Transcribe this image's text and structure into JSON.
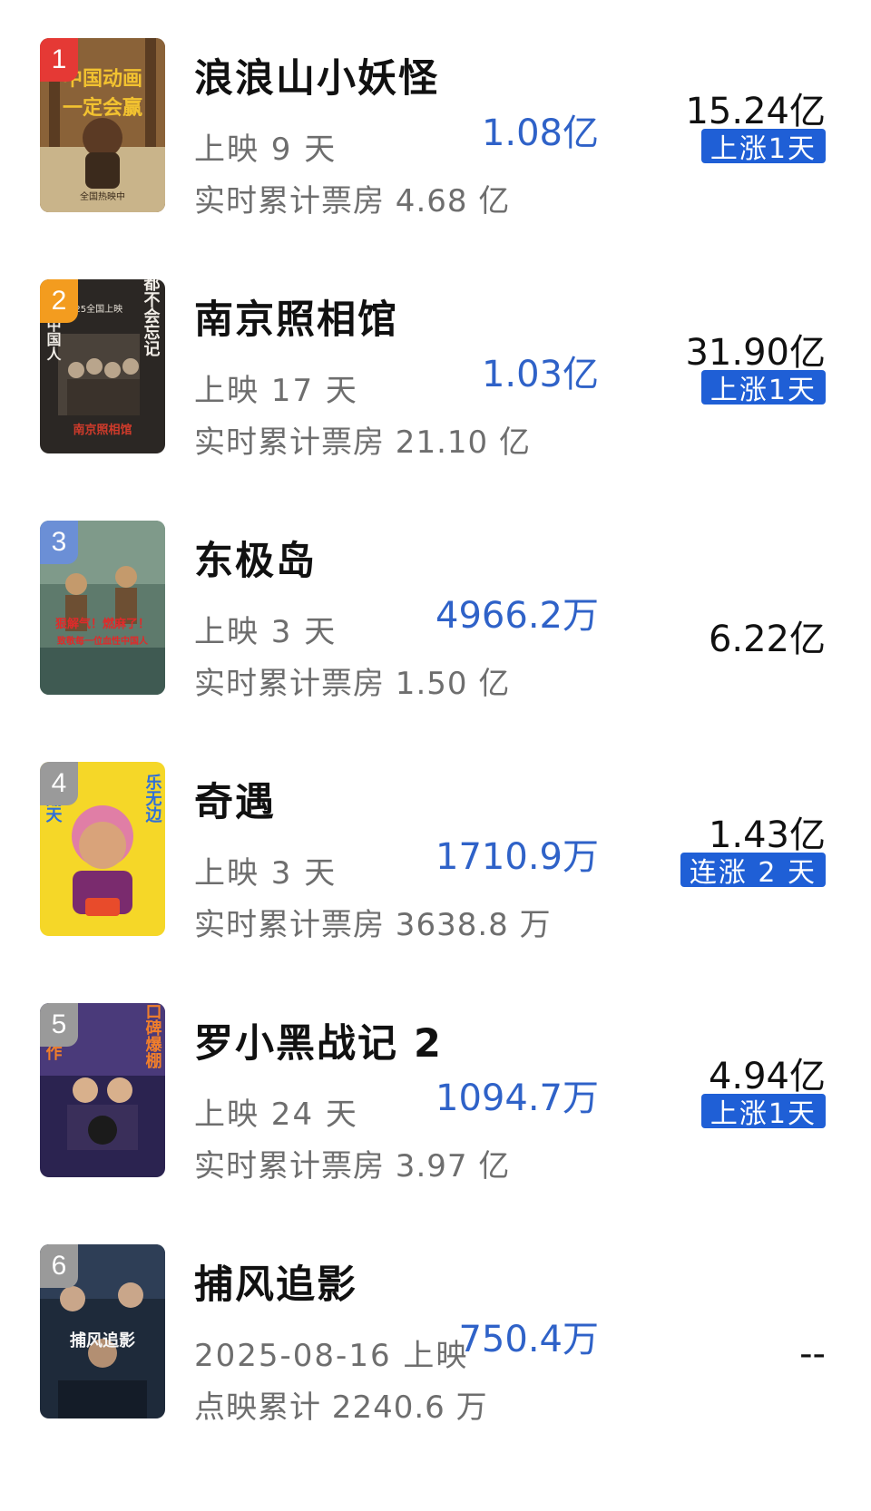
{
  "movies": [
    {
      "rank": "1",
      "rank_color": "#e53935",
      "title": "浪浪山小妖怪",
      "days": "上映 9 天",
      "cume": "实时累计票房 4.68 亿",
      "daily": "1.08亿",
      "total": "15.24亿",
      "badge": "上涨1天",
      "poster_icon": "poster-langlangshan",
      "poster_text": [
        "中国动画",
        "一定会赢",
        "全国热映中"
      ]
    },
    {
      "rank": "2",
      "rank_color": "#f39c1f",
      "title": "南京照相馆",
      "days": "上映 17 天",
      "cume": "实时累计票房 21.10 亿",
      "daily": "1.03亿",
      "total": "31.90亿",
      "badge": "上涨1天",
      "poster_icon": "poster-nanjing",
      "poster_text": [
        "都不会忘记",
        "一个中国人",
        "南京照相馆",
        "7.25全国上映"
      ]
    },
    {
      "rank": "3",
      "rank_color": "#6b8fd6",
      "title": "东极岛",
      "days": "上映 3 天",
      "cume": "实时累计票房 1.50 亿",
      "daily": "4966.2万",
      "total": "6.22亿",
      "badge": "",
      "poster_icon": "poster-dongjidao",
      "poster_text": [
        "狠解气！燃麻了！",
        "致敬每一位血性中国人"
      ]
    },
    {
      "rank": "4",
      "rank_color": "#9a9a9a",
      "title": "奇遇",
      "days": "上映 3 天",
      "cume": "实时累计票房 3638.8 万",
      "daily": "1710.9万",
      "total": "1.43亿",
      "badge": "连涨 2 天",
      "poster_icon": "poster-qiyu",
      "poster_text": [
        "笑翻天",
        "乐无边"
      ]
    },
    {
      "rank": "5",
      "rank_color": "#9a9a9a",
      "title": "罗小黑战记 2",
      "days": "上映 24 天",
      "cume": "实时累计票房 3.97 亿",
      "daily": "1094.7万",
      "total": "4.94亿",
      "badge": "上涨1天",
      "poster_icon": "poster-luoxiaohei",
      "poster_text": [
        "燃制作",
        "口碑爆棚"
      ]
    },
    {
      "rank": "6",
      "rank_color": "#9a9a9a",
      "title": "捕风追影",
      "days": "2025-08-16 上映",
      "cume": "点映累计 2240.6 万",
      "daily": "750.4万",
      "total": "--",
      "badge": "",
      "poster_icon": "poster-bufengzhuiying",
      "poster_text": [
        "捕风追影"
      ]
    }
  ]
}
